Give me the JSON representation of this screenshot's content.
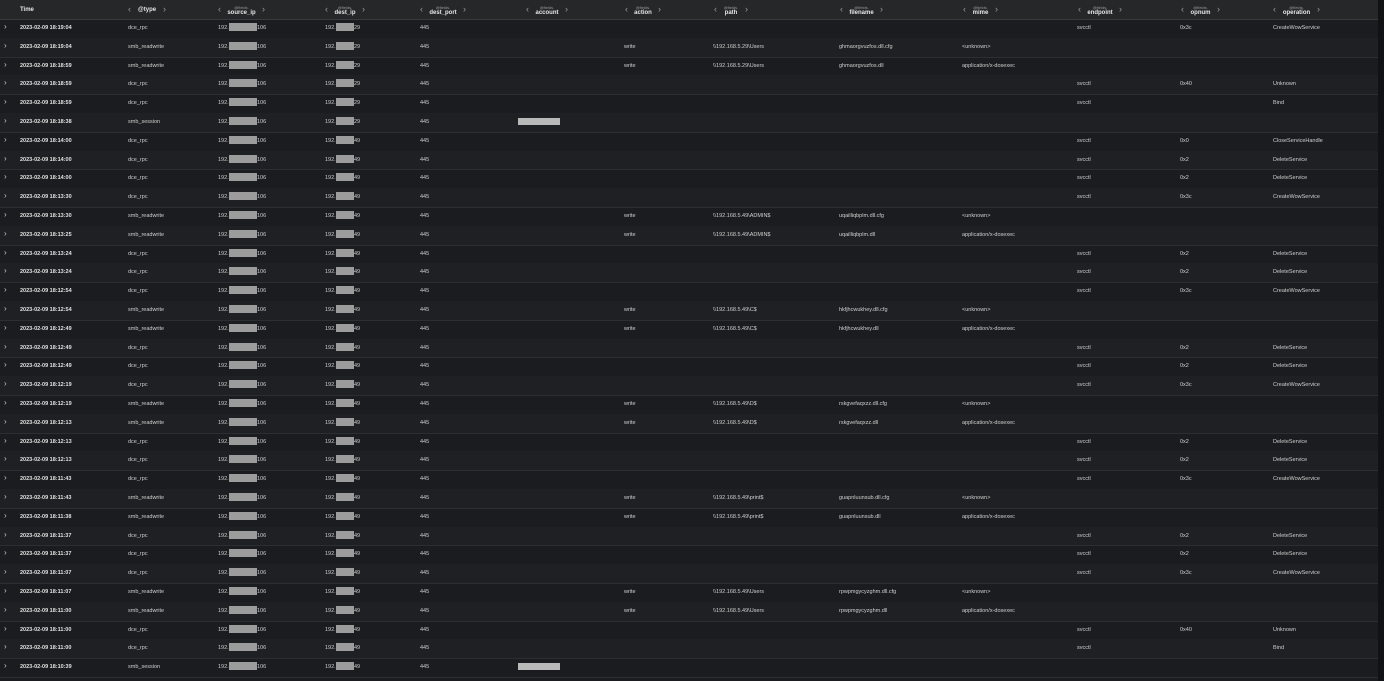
{
  "header": {
    "time_label": "Time",
    "field_prefix": "@fields.",
    "columns": [
      "@type",
      "source_ip",
      "dest_ip",
      "dest_port",
      "account",
      "action",
      "path",
      "filename",
      "mime",
      "endpoint",
      "opnum",
      "operation"
    ],
    "arrow_left": "‹",
    "arrow_right": "›"
  },
  "expand_glyph": "›",
  "rows": [
    {
      "time": "2023-02-09 18:19:04",
      "type": "dce_rpc",
      "src_pre": "192.",
      "src_suf": "106",
      "dst_pre": "192.",
      "dst_suf": "29",
      "port": "445",
      "account": false,
      "action": "",
      "path": "",
      "filename": "",
      "mime": "",
      "endpoint": "svcctl",
      "opnum": "0x3c",
      "operation": "CreateWowService"
    },
    {
      "time": "2023-02-09 18:19:04",
      "type": "smb_readwrite",
      "src_pre": "192.",
      "src_suf": "106",
      "dst_pre": "192.",
      "dst_suf": "29",
      "port": "445",
      "account": false,
      "action": "write",
      "path": "\\\\192.168.5.29\\Users",
      "filename": "ghmaorgvuzfos.dll.cfg",
      "mime": "<unknown>",
      "endpoint": "",
      "opnum": "",
      "operation": ""
    },
    {
      "time": "2023-02-09 18:18:59",
      "type": "smb_readwrite",
      "src_pre": "192.",
      "src_suf": "106",
      "dst_pre": "192.",
      "dst_suf": "29",
      "port": "445",
      "account": false,
      "action": "write",
      "path": "\\\\192.168.5.29\\Users",
      "filename": "ghmaorgvuzfos.dll",
      "mime": "application/x-dosexec",
      "endpoint": "",
      "opnum": "",
      "operation": ""
    },
    {
      "time": "2023-02-09 18:18:59",
      "type": "dce_rpc",
      "src_pre": "192.",
      "src_suf": "106",
      "dst_pre": "192.",
      "dst_suf": "29",
      "port": "445",
      "account": false,
      "action": "",
      "path": "",
      "filename": "",
      "mime": "",
      "endpoint": "svcctl",
      "opnum": "0x40",
      "operation": "Unknown"
    },
    {
      "time": "2023-02-09 18:18:59",
      "type": "dce_rpc",
      "src_pre": "192.",
      "src_suf": "106",
      "dst_pre": "192.",
      "dst_suf": "29",
      "port": "445",
      "account": false,
      "action": "",
      "path": "",
      "filename": "",
      "mime": "",
      "endpoint": "svcctl",
      "opnum": "",
      "operation": "Bind"
    },
    {
      "time": "2023-02-09 18:18:38",
      "type": "smb_session",
      "src_pre": "192.",
      "src_suf": "106",
      "dst_pre": "192.",
      "dst_suf": "29",
      "port": "445",
      "account": true,
      "action": "",
      "path": "",
      "filename": "",
      "mime": "",
      "endpoint": "",
      "opnum": "",
      "operation": ""
    },
    {
      "time": "2023-02-09 18:14:00",
      "type": "dce_rpc",
      "src_pre": "192.",
      "src_suf": "106",
      "dst_pre": "192.",
      "dst_suf": "49",
      "port": "445",
      "account": false,
      "action": "",
      "path": "",
      "filename": "",
      "mime": "",
      "endpoint": "svcctl",
      "opnum": "0x0",
      "operation": "CloseServiceHandle"
    },
    {
      "time": "2023-02-09 18:14:00",
      "type": "dce_rpc",
      "src_pre": "192.",
      "src_suf": "106",
      "dst_pre": "192.",
      "dst_suf": "49",
      "port": "445",
      "account": false,
      "action": "",
      "path": "",
      "filename": "",
      "mime": "",
      "endpoint": "svcctl",
      "opnum": "0x2",
      "operation": "DeleteService"
    },
    {
      "time": "2023-02-09 18:14:00",
      "type": "dce_rpc",
      "src_pre": "192.",
      "src_suf": "106",
      "dst_pre": "192.",
      "dst_suf": "49",
      "port": "445",
      "account": false,
      "action": "",
      "path": "",
      "filename": "",
      "mime": "",
      "endpoint": "svcctl",
      "opnum": "0x2",
      "operation": "DeleteService"
    },
    {
      "time": "2023-02-09 18:13:30",
      "type": "dce_rpc",
      "src_pre": "192.",
      "src_suf": "106",
      "dst_pre": "192.",
      "dst_suf": "49",
      "port": "445",
      "account": false,
      "action": "",
      "path": "",
      "filename": "",
      "mime": "",
      "endpoint": "svcctl",
      "opnum": "0x3c",
      "operation": "CreateWowService"
    },
    {
      "time": "2023-02-09 18:13:30",
      "type": "smb_readwrite",
      "src_pre": "192.",
      "src_suf": "106",
      "dst_pre": "192.",
      "dst_suf": "49",
      "port": "445",
      "account": false,
      "action": "write",
      "path": "\\\\192.168.5.49\\ADMIN$",
      "filename": "uqailliqbplm.dll.cfg",
      "mime": "<unknown>",
      "endpoint": "",
      "opnum": "",
      "operation": ""
    },
    {
      "time": "2023-02-09 18:13:25",
      "type": "smb_readwrite",
      "src_pre": "192.",
      "src_suf": "106",
      "dst_pre": "192.",
      "dst_suf": "49",
      "port": "445",
      "account": false,
      "action": "write",
      "path": "\\\\192.168.5.49\\ADMIN$",
      "filename": "uqailliqbplm.dll",
      "mime": "application/x-dosexec",
      "endpoint": "",
      "opnum": "",
      "operation": ""
    },
    {
      "time": "2023-02-09 18:13:24",
      "type": "dce_rpc",
      "src_pre": "192.",
      "src_suf": "106",
      "dst_pre": "192.",
      "dst_suf": "49",
      "port": "445",
      "account": false,
      "action": "",
      "path": "",
      "filename": "",
      "mime": "",
      "endpoint": "svcctl",
      "opnum": "0x2",
      "operation": "DeleteService"
    },
    {
      "time": "2023-02-09 18:13:24",
      "type": "dce_rpc",
      "src_pre": "192.",
      "src_suf": "106",
      "dst_pre": "192.",
      "dst_suf": "49",
      "port": "445",
      "account": false,
      "action": "",
      "path": "",
      "filename": "",
      "mime": "",
      "endpoint": "svcctl",
      "opnum": "0x2",
      "operation": "DeleteService"
    },
    {
      "time": "2023-02-09 18:12:54",
      "type": "dce_rpc",
      "src_pre": "192.",
      "src_suf": "106",
      "dst_pre": "192.",
      "dst_suf": "49",
      "port": "445",
      "account": false,
      "action": "",
      "path": "",
      "filename": "",
      "mime": "",
      "endpoint": "svcctl",
      "opnum": "0x3c",
      "operation": "CreateWowService"
    },
    {
      "time": "2023-02-09 18:12:54",
      "type": "smb_readwrite",
      "src_pre": "192.",
      "src_suf": "106",
      "dst_pre": "192.",
      "dst_suf": "49",
      "port": "445",
      "account": false,
      "action": "write",
      "path": "\\\\192.168.5.49\\C$",
      "filename": "hkfjhcwukhey.dll.cfg",
      "mime": "<unknown>",
      "endpoint": "",
      "opnum": "",
      "operation": ""
    },
    {
      "time": "2023-02-09 18:12:49",
      "type": "smb_readwrite",
      "src_pre": "192.",
      "src_suf": "106",
      "dst_pre": "192.",
      "dst_suf": "49",
      "port": "445",
      "account": false,
      "action": "write",
      "path": "\\\\192.168.5.49\\C$",
      "filename": "hkfjhcwukhey.dll",
      "mime": "application/x-dosexec",
      "endpoint": "",
      "opnum": "",
      "operation": ""
    },
    {
      "time": "2023-02-09 18:12:49",
      "type": "dce_rpc",
      "src_pre": "192.",
      "src_suf": "106",
      "dst_pre": "192.",
      "dst_suf": "49",
      "port": "445",
      "account": false,
      "action": "",
      "path": "",
      "filename": "",
      "mime": "",
      "endpoint": "svcctl",
      "opnum": "0x2",
      "operation": "DeleteService"
    },
    {
      "time": "2023-02-09 18:12:49",
      "type": "dce_rpc",
      "src_pre": "192.",
      "src_suf": "106",
      "dst_pre": "192.",
      "dst_suf": "49",
      "port": "445",
      "account": false,
      "action": "",
      "path": "",
      "filename": "",
      "mime": "",
      "endpoint": "svcctl",
      "opnum": "0x2",
      "operation": "DeleteService"
    },
    {
      "time": "2023-02-09 18:12:19",
      "type": "dce_rpc",
      "src_pre": "192.",
      "src_suf": "106",
      "dst_pre": "192.",
      "dst_suf": "49",
      "port": "445",
      "account": false,
      "action": "",
      "path": "",
      "filename": "",
      "mime": "",
      "endpoint": "svcctl",
      "opnum": "0x3c",
      "operation": "CreateWowService"
    },
    {
      "time": "2023-02-09 18:12:19",
      "type": "smb_readwrite",
      "src_pre": "192.",
      "src_suf": "106",
      "dst_pre": "192.",
      "dst_suf": "49",
      "port": "445",
      "account": false,
      "action": "write",
      "path": "\\\\192.168.5.49\\D$",
      "filename": "rskgvefaqxzz.dll.cfg",
      "mime": "<unknown>",
      "endpoint": "",
      "opnum": "",
      "operation": ""
    },
    {
      "time": "2023-02-09 18:12:13",
      "type": "smb_readwrite",
      "src_pre": "192.",
      "src_suf": "106",
      "dst_pre": "192.",
      "dst_suf": "49",
      "port": "445",
      "account": false,
      "action": "write",
      "path": "\\\\192.168.5.49\\D$",
      "filename": "rskgvefaqxzz.dll",
      "mime": "application/x-dosexec",
      "endpoint": "",
      "opnum": "",
      "operation": ""
    },
    {
      "time": "2023-02-09 18:12:13",
      "type": "dce_rpc",
      "src_pre": "192.",
      "src_suf": "106",
      "dst_pre": "192.",
      "dst_suf": "49",
      "port": "445",
      "account": false,
      "action": "",
      "path": "",
      "filename": "",
      "mime": "",
      "endpoint": "svcctl",
      "opnum": "0x2",
      "operation": "DeleteService"
    },
    {
      "time": "2023-02-09 18:12:13",
      "type": "dce_rpc",
      "src_pre": "192.",
      "src_suf": "106",
      "dst_pre": "192.",
      "dst_suf": "49",
      "port": "445",
      "account": false,
      "action": "",
      "path": "",
      "filename": "",
      "mime": "",
      "endpoint": "svcctl",
      "opnum": "0x2",
      "operation": "DeleteService"
    },
    {
      "time": "2023-02-09 18:11:43",
      "type": "dce_rpc",
      "src_pre": "192.",
      "src_suf": "106",
      "dst_pre": "192.",
      "dst_suf": "49",
      "port": "445",
      "account": false,
      "action": "",
      "path": "",
      "filename": "",
      "mime": "",
      "endpoint": "svcctl",
      "opnum": "0x3c",
      "operation": "CreateWowService"
    },
    {
      "time": "2023-02-09 18:11:43",
      "type": "smb_readwrite",
      "src_pre": "192.",
      "src_suf": "106",
      "dst_pre": "192.",
      "dst_suf": "49",
      "port": "445",
      "account": false,
      "action": "write",
      "path": "\\\\192.168.5.49\\print$",
      "filename": "guapnluunsub.dll.cfg",
      "mime": "<unknown>",
      "endpoint": "",
      "opnum": "",
      "operation": ""
    },
    {
      "time": "2023-02-09 18:11:38",
      "type": "smb_readwrite",
      "src_pre": "192.",
      "src_suf": "106",
      "dst_pre": "192.",
      "dst_suf": "49",
      "port": "445",
      "account": false,
      "action": "write",
      "path": "\\\\192.168.5.49\\print$",
      "filename": "guapnluunsub.dll",
      "mime": "application/x-dosexec",
      "endpoint": "",
      "opnum": "",
      "operation": ""
    },
    {
      "time": "2023-02-09 18:11:37",
      "type": "dce_rpc",
      "src_pre": "192.",
      "src_suf": "106",
      "dst_pre": "192.",
      "dst_suf": "49",
      "port": "445",
      "account": false,
      "action": "",
      "path": "",
      "filename": "",
      "mime": "",
      "endpoint": "svcctl",
      "opnum": "0x2",
      "operation": "DeleteService"
    },
    {
      "time": "2023-02-09 18:11:37",
      "type": "dce_rpc",
      "src_pre": "192.",
      "src_suf": "106",
      "dst_pre": "192.",
      "dst_suf": "49",
      "port": "445",
      "account": false,
      "action": "",
      "path": "",
      "filename": "",
      "mime": "",
      "endpoint": "svcctl",
      "opnum": "0x2",
      "operation": "DeleteService"
    },
    {
      "time": "2023-02-09 18:11:07",
      "type": "dce_rpc",
      "src_pre": "192.",
      "src_suf": "106",
      "dst_pre": "192.",
      "dst_suf": "49",
      "port": "445",
      "account": false,
      "action": "",
      "path": "",
      "filename": "",
      "mime": "",
      "endpoint": "svcctl",
      "opnum": "0x3c",
      "operation": "CreateWowService"
    },
    {
      "time": "2023-02-09 18:11:07",
      "type": "smb_readwrite",
      "src_pre": "192.",
      "src_suf": "106",
      "dst_pre": "192.",
      "dst_suf": "49",
      "port": "445",
      "account": false,
      "action": "write",
      "path": "\\\\192.168.5.49\\Users",
      "filename": "rpwpmgycyzghm.dll.cfg",
      "mime": "<unknown>",
      "endpoint": "",
      "opnum": "",
      "operation": ""
    },
    {
      "time": "2023-02-09 18:11:00",
      "type": "smb_readwrite",
      "src_pre": "192.",
      "src_suf": "106",
      "dst_pre": "192.",
      "dst_suf": "49",
      "port": "445",
      "account": false,
      "action": "write",
      "path": "\\\\192.168.5.49\\Users",
      "filename": "rpwpmgycyzghm.dll",
      "mime": "application/x-dosexec",
      "endpoint": "",
      "opnum": "",
      "operation": ""
    },
    {
      "time": "2023-02-09 18:11:00",
      "type": "dce_rpc",
      "src_pre": "192.",
      "src_suf": "106",
      "dst_pre": "192.",
      "dst_suf": "49",
      "port": "445",
      "account": false,
      "action": "",
      "path": "",
      "filename": "",
      "mime": "",
      "endpoint": "svcctl",
      "opnum": "0x40",
      "operation": "Unknown"
    },
    {
      "time": "2023-02-09 18:11:00",
      "type": "dce_rpc",
      "src_pre": "192.",
      "src_suf": "106",
      "dst_pre": "192.",
      "dst_suf": "49",
      "port": "445",
      "account": false,
      "action": "",
      "path": "",
      "filename": "",
      "mime": "",
      "endpoint": "svcctl",
      "opnum": "",
      "operation": "Bind"
    },
    {
      "time": "2023-02-09 18:10:39",
      "type": "smb_session",
      "src_pre": "192.",
      "src_suf": "106",
      "dst_pre": "192.",
      "dst_suf": "49",
      "port": "445",
      "account": true,
      "action": "",
      "path": "",
      "filename": "",
      "mime": "",
      "endpoint": "",
      "opnum": "",
      "operation": ""
    }
  ]
}
